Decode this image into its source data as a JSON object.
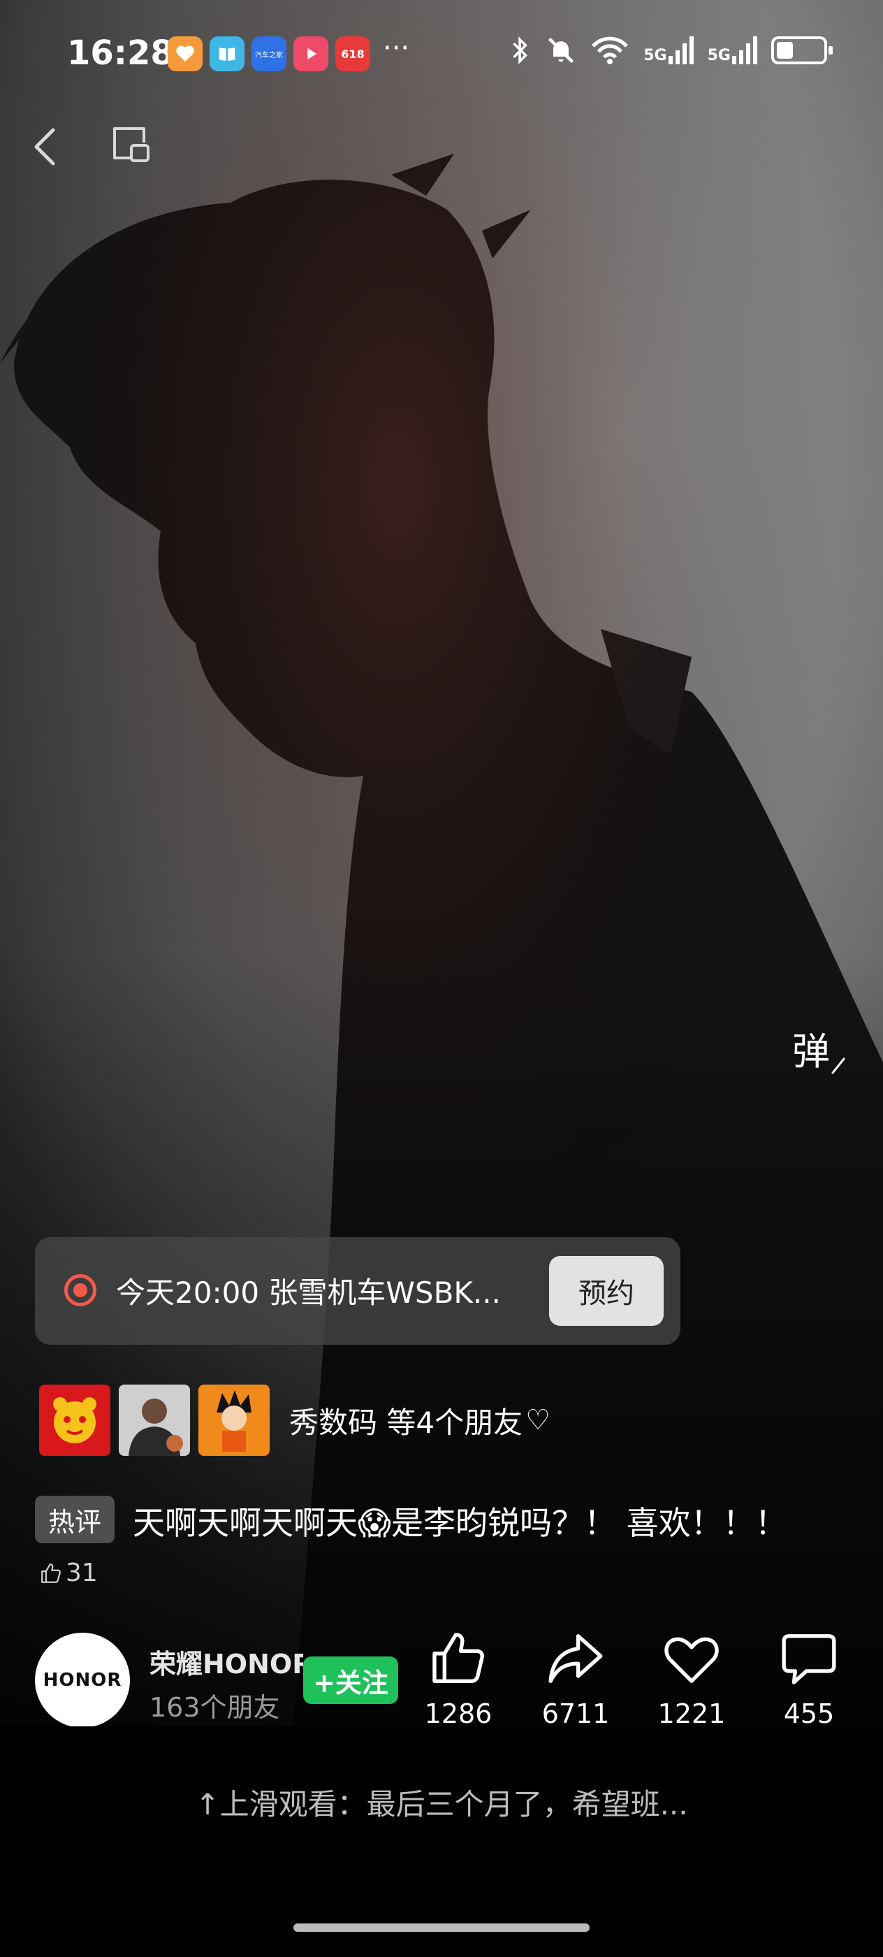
{
  "status_bar": {
    "time": "16:28",
    "app_icons": [
      {
        "name": "heart-app-icon",
        "color": "#f59a3b"
      },
      {
        "name": "book-app-icon",
        "color": "#3fb6e6"
      },
      {
        "name": "autohome-app-icon",
        "color": "#2f72e6",
        "label": "汽车之家"
      },
      {
        "name": "video-app-icon",
        "color": "#f04a6a"
      },
      {
        "name": "shopping-618-app-icon",
        "color": "#e83a3a",
        "label": "618"
      }
    ],
    "more": "···",
    "signal_1": "5G",
    "signal_2": "5G",
    "battery_level": 0.38
  },
  "danmu_button": "弹",
  "live_reservation": {
    "text": "今天20:00 张雪机车WSBK...",
    "button_label": "预约",
    "accent": "#f35a4e"
  },
  "friends": {
    "text": "秀数码 等4个朋友"
  },
  "hot_comment": {
    "badge": "热评",
    "text": "天啊天啊天啊天😱是李昀锐吗？！ 喜欢！！！",
    "likes": "31"
  },
  "author": {
    "avatar_text": "HONOR",
    "name": "荣耀HONOR",
    "subtitle": "163个朋友",
    "follow_label": "+关注",
    "follow_color": "#1fc15a"
  },
  "actions": {
    "like_count": "1286",
    "share_count": "6711",
    "favorite_count": "1221",
    "comment_count": "455"
  },
  "swipe_hint": "↑上滑观看：最后三个月了，希望班..."
}
